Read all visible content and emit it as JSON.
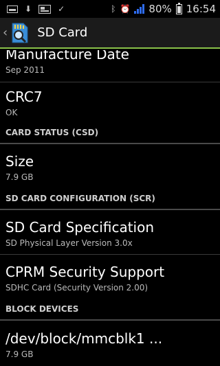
{
  "status_bar": {
    "battery": "80%",
    "time": "16:54"
  },
  "action_bar": {
    "title": "SD Card",
    "back_glyph": "‹"
  },
  "items_top": [
    {
      "title": "Manufacture Date",
      "subtitle": "Sep 2011"
    },
    {
      "title": "CRC7",
      "subtitle": "OK"
    }
  ],
  "section_csd": "CARD STATUS (CSD)",
  "size_item": {
    "title": "Size",
    "subtitle": "7.9 GB"
  },
  "section_scr": "SD CARD CONFIGURATION (SCR)",
  "scr_items": [
    {
      "title": "SD Card Specification",
      "subtitle": "SD Physical Layer Version 3.0x"
    },
    {
      "title": "CPRM Security Support",
      "subtitle": "SDHC Card (Security Version 2.00)"
    }
  ],
  "section_block": "BLOCK DEVICES",
  "block_item": {
    "title": "/dev/block/mmcblk1 ...",
    "subtitle": "7.9 GB"
  },
  "colors": {
    "accent": "#8bc34a",
    "signal": "#2e6cf0"
  }
}
